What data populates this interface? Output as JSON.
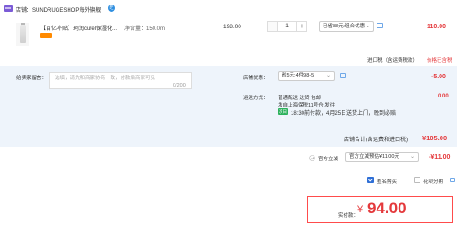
{
  "store": {
    "label": "店铺：SUNDRUGESHOP海外旗舰",
    "badge": "旺"
  },
  "product": {
    "title": "【百亿补贴】珂润curel保湿化...",
    "spec": "净含量：150.0ml",
    "unit_price": "198.00",
    "quantity": "1",
    "qty_minus": "−",
    "qty_plus": "+",
    "promo": "已省88元:组合优惠",
    "line_total": "110.00"
  },
  "tax": {
    "label": "进口税（含运费税款）",
    "value": "价格已含税"
  },
  "note": {
    "label": "给卖家留言：",
    "placeholder": "选填，请先和商家协商一致，付款后商家可见",
    "count": "0/200"
  },
  "shop_discount": {
    "label": "店铺优惠：",
    "selected": "省5元:4件98-5",
    "value": "-5.00"
  },
  "shipping": {
    "label": "运送方式：",
    "method": "普通配送 送货 包邮",
    "from": "发自上海保税11号仓   发往",
    "badge": "次日达",
    "eta": "18:30前付款，4月25日送货上门，晚到必赔",
    "fee": "0.00"
  },
  "subtotal": {
    "label": "店铺合计(含运费和进口税)",
    "value": "¥105.00"
  },
  "platform": {
    "label": "官方立减",
    "selected": "官方立减预估¥11.00元",
    "value": "-¥11.00"
  },
  "options": {
    "anonymous": "匿名购买",
    "split": "花呗分期"
  },
  "payment": {
    "label": "实付款：",
    "currency": "¥",
    "amount": "94.00"
  },
  "colors": {
    "accent": "#e4393c",
    "panel": "#eef4fb",
    "link": "#2f6fd6"
  }
}
